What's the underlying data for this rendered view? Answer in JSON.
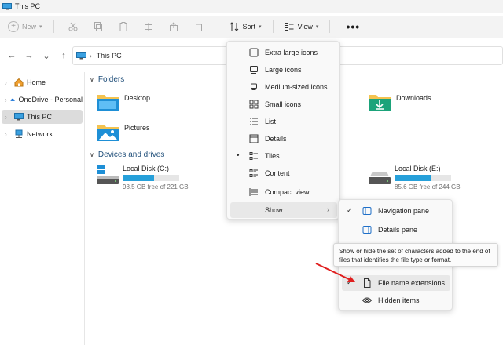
{
  "window": {
    "title": "This PC"
  },
  "toolbar": {
    "new_label": "New",
    "sort_label": "Sort",
    "view_label": "View"
  },
  "address": {
    "path": "This PC"
  },
  "sidebar": {
    "items": [
      {
        "label": "Home"
      },
      {
        "label": "OneDrive - Personal"
      },
      {
        "label": "This PC"
      },
      {
        "label": "Network"
      }
    ]
  },
  "content": {
    "folders_header": "Folders",
    "folders": [
      {
        "label": "Desktop"
      },
      {
        "label": "Downloads"
      },
      {
        "label": "Pictures"
      }
    ],
    "drives_header": "Devices and drives",
    "drives": [
      {
        "name": "Local Disk (C:)",
        "free_text": "98.5 GB free of 221 GB",
        "used_fraction": 0.55
      },
      {
        "name": "Local Disk (E:)",
        "free_text": "85.6 GB free of 244 GB",
        "used_fraction": 0.65
      }
    ]
  },
  "view_menu": {
    "items": [
      {
        "label": "Extra large icons"
      },
      {
        "label": "Large icons"
      },
      {
        "label": "Medium-sized icons"
      },
      {
        "label": "Small icons"
      },
      {
        "label": "List"
      },
      {
        "label": "Details"
      },
      {
        "label": "Tiles",
        "selected": true
      },
      {
        "label": "Content"
      },
      {
        "label": "Compact view"
      },
      {
        "label": "Show"
      }
    ]
  },
  "show_menu": {
    "items": [
      {
        "label": "Navigation pane",
        "checked": true
      },
      {
        "label": "Details pane",
        "checked": false
      },
      {
        "label": "File name extensions",
        "checked": true
      },
      {
        "label": "Hidden items",
        "checked": false
      }
    ]
  },
  "tooltip": {
    "text": "Show or hide the set of characters added to the end of files that identifies the file type or format."
  },
  "colors": {
    "accent": "#26a0da",
    "folder_header": "#1f4e79",
    "annotation_arrow": "#e01e1e"
  }
}
